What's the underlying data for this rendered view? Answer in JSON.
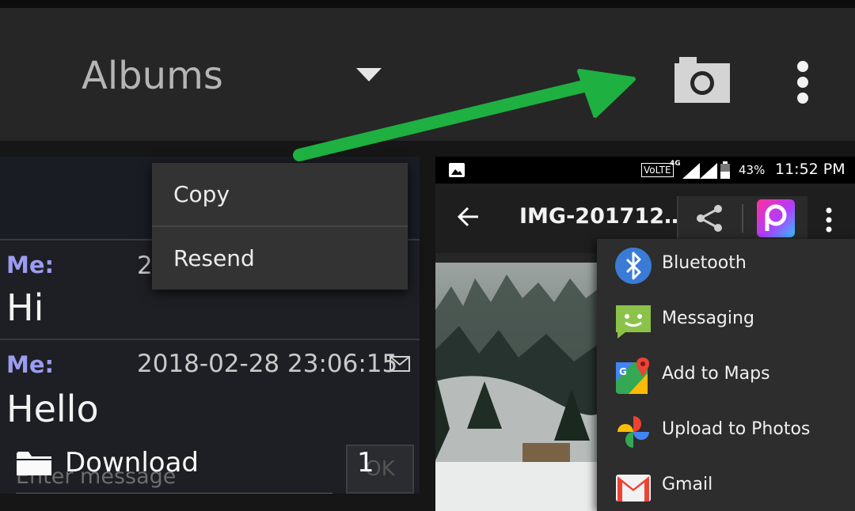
{
  "toolbar": {
    "title": "Albums"
  },
  "sms": {
    "messages": [
      {
        "sender": "Me:",
        "timestamp": "2",
        "body": "Hi"
      },
      {
        "sender": "Me:",
        "timestamp": "2018-02-28 23:06:15",
        "body": "Hello"
      }
    ],
    "input_placeholder": "Enter message",
    "ok_label": "OK"
  },
  "context_menu": {
    "items": [
      "Copy",
      "Resend"
    ]
  },
  "folder": {
    "name": "Download",
    "count": "1"
  },
  "phone": {
    "status": {
      "network": "VoLTE",
      "network_gen": "4G",
      "battery": "43%",
      "time": "11:52 PM"
    },
    "title": "IMG-201712…",
    "share_targets": [
      {
        "label": "Bluetooth",
        "icon": "bluetooth-icon"
      },
      {
        "label": "Messaging",
        "icon": "messaging-icon"
      },
      {
        "label": "Add to Maps",
        "icon": "maps-icon"
      },
      {
        "label": "Upload to Photos",
        "icon": "photos-icon"
      },
      {
        "label": "Gmail",
        "icon": "gmail-icon"
      }
    ]
  },
  "colors": {
    "annotation_arrow": "#1eb040",
    "sender": "#9c9cf2",
    "toolbar_bg": "#262626"
  }
}
